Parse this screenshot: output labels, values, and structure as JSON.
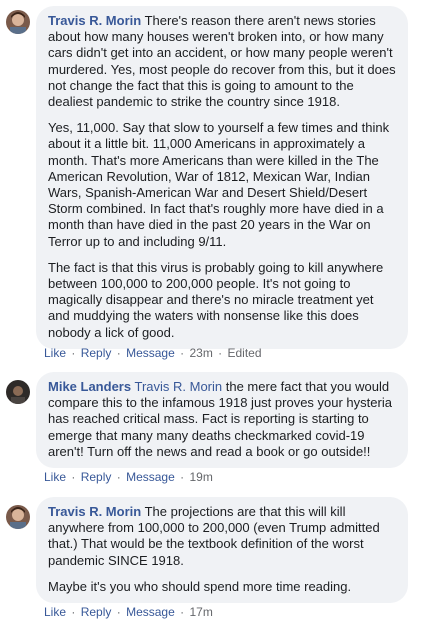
{
  "comments": [
    {
      "author": "Travis R. Morin",
      "paragraphs": [
        "There's reason there aren't news stories about how many houses weren't broken into, or how many cars didn't get into an accident, or how many people weren't murdered. Yes, most people do recover from this, but it does not change the fact that this is going to amount to the dealiest pandemic to strike the country since 1918.",
        "Yes, 11,000. Say that slow to yourself a few times and think about it a little bit. 11,000 Americans in approximately a month. That's more Americans than were killed in the The American Revolution, War of 1812, Mexican War, Indian Wars, Spanish-American War and Desert Shield/Desert Storm combined. In fact that's roughly more have died in a month than have died in the past 20 years in the War on Terror up to and including 9/11.",
        "The fact is that this virus is probably going to kill anywhere between 100,000 to 200,000 people. It's not going to magically disappear and there's no miracle treatment yet and muddying the waters with nonsense like this does nobody a lick of good."
      ],
      "like": "Like",
      "reply": "Reply",
      "message": "Message",
      "time": "23m",
      "edited": "Edited"
    },
    {
      "author": "Mike Landers",
      "mention": "Travis R. Morin",
      "text": "the mere fact that you would compare this to the infamous 1918 just proves your hysteria has reached critical mass. Fact is reporting is starting to emerge that many many deaths checkmarked covid-19 aren't! Turn off the news and read a book or go outside!!",
      "like": "Like",
      "reply": "Reply",
      "message": "Message",
      "time": "19m"
    },
    {
      "author": "Travis R. Morin",
      "paragraphs": [
        "The projections are that this will kill anywhere from 100,000 to 200,000 (even Trump admitted that.) That would be the textbook definition of the worst pandemic SINCE 1918.",
        "Maybe it's you who should spend more time reading."
      ],
      "like": "Like",
      "reply": "Reply",
      "message": "Message",
      "time": "17m"
    }
  ],
  "separator": "·"
}
